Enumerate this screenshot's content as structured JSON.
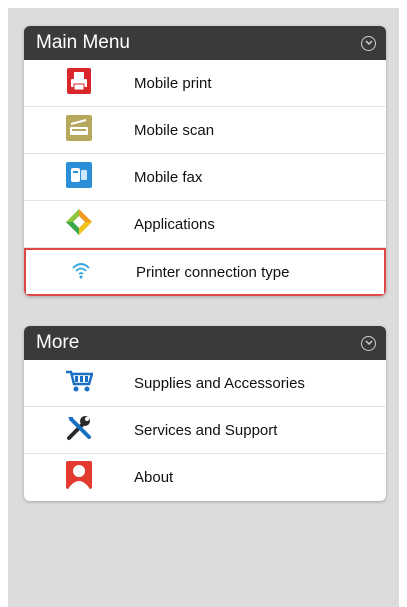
{
  "main_menu": {
    "title": "Main Menu",
    "items": [
      {
        "label": "Mobile print",
        "icon": "printer-icon"
      },
      {
        "label": "Mobile scan",
        "icon": "scanner-icon"
      },
      {
        "label": "Mobile fax",
        "icon": "fax-icon"
      },
      {
        "label": "Applications",
        "icon": "applications-icon"
      },
      {
        "label": "Printer connection type",
        "icon": "wifi-icon"
      }
    ]
  },
  "more_menu": {
    "title": "More",
    "items": [
      {
        "label": "Supplies and Accessories",
        "icon": "cart-icon"
      },
      {
        "label": "Services and Support",
        "icon": "tools-icon"
      },
      {
        "label": "About",
        "icon": "person-icon"
      }
    ]
  },
  "colors": {
    "header_bg": "#3a3a3a",
    "highlight_border": "#e04848",
    "screen_bg": "#dcdcdc"
  }
}
